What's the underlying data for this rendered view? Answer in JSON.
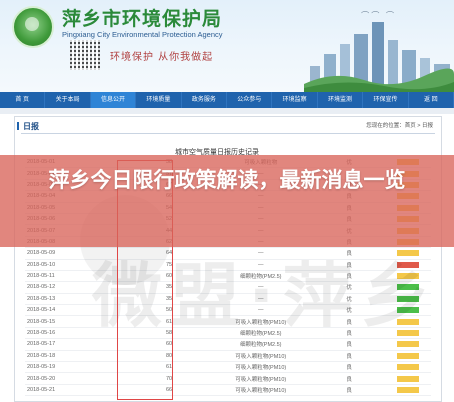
{
  "header": {
    "org_cn": "萍乡市环境保护局",
    "org_en": "Pingxiang City Environmental Protection Agency",
    "slogan": "环境保护 从你我做起",
    "logo_icon": "environment-agency-logo"
  },
  "nav": {
    "items": [
      "首 页",
      "关于本局",
      "信息公开",
      "环境质量",
      "政务服务",
      "公众参与",
      "环境监察",
      "环境监测",
      "环保宣传",
      "返 回"
    ],
    "active_index": 2
  },
  "panel": {
    "title": "日报",
    "breadcrumb": "您现在的位置：首页 > 日报",
    "table_caption": "城市空气质量日报历史记录"
  },
  "table": {
    "rows": [
      {
        "date": "2018-05-01",
        "aqi": "38",
        "pollutant": "可吸入颗粒物",
        "level": "优",
        "color": "#f4c84a"
      },
      {
        "date": "2018-05-02",
        "aqi": "51",
        "pollutant": "—",
        "level": "优",
        "color": "#f4c84a"
      },
      {
        "date": "2018-05-03",
        "aqi": "67",
        "pollutant": "—",
        "level": "良",
        "color": "#f4c84a"
      },
      {
        "date": "2018-05-04",
        "aqi": "66",
        "pollutant": "—",
        "level": "良",
        "color": "#f4c84a"
      },
      {
        "date": "2018-05-05",
        "aqi": "54",
        "pollutant": "—",
        "level": "良",
        "color": "#f4c84a"
      },
      {
        "date": "2018-05-06",
        "aqi": "52",
        "pollutant": "—",
        "level": "良",
        "color": "#f4c84a"
      },
      {
        "date": "2018-05-07",
        "aqi": "44",
        "pollutant": "—",
        "level": "优",
        "color": "#f4c84a"
      },
      {
        "date": "2018-05-08",
        "aqi": "62",
        "pollutant": "—",
        "level": "良",
        "color": "#f4c84a"
      },
      {
        "date": "2018-05-09",
        "aqi": "64",
        "pollutant": "—",
        "level": "良",
        "color": "#f4c84a"
      },
      {
        "date": "2018-05-10",
        "aqi": "75",
        "pollutant": "—",
        "level": "良",
        "color": "#e05a4a"
      },
      {
        "date": "2018-05-11",
        "aqi": "60",
        "pollutant": "细颗粒物(PM2.5)",
        "level": "良",
        "color": "#f4c84a"
      },
      {
        "date": "2018-05-12",
        "aqi": "35",
        "pollutant": "—",
        "level": "优",
        "color": "#4cbf4a"
      },
      {
        "date": "2018-05-13",
        "aqi": "35",
        "pollutant": "—",
        "level": "优",
        "color": "#4cbf4a"
      },
      {
        "date": "2018-05-14",
        "aqi": "50",
        "pollutant": "—",
        "level": "优",
        "color": "#4cbf4a"
      },
      {
        "date": "2018-05-15",
        "aqi": "61",
        "pollutant": "可吸入颗粒物(PM10)",
        "level": "良",
        "color": "#f4c84a"
      },
      {
        "date": "2018-05-16",
        "aqi": "58",
        "pollutant": "细颗粒物(PM2.5)",
        "level": "良",
        "color": "#f4c84a"
      },
      {
        "date": "2018-05-17",
        "aqi": "60",
        "pollutant": "细颗粒物(PM2.5)",
        "level": "良",
        "color": "#f4c84a"
      },
      {
        "date": "2018-05-18",
        "aqi": "80",
        "pollutant": "可吸入颗粒物(PM10)",
        "level": "良",
        "color": "#f4c84a"
      },
      {
        "date": "2018-05-19",
        "aqi": "61",
        "pollutant": "可吸入颗粒物(PM10)",
        "level": "良",
        "color": "#f4c84a"
      },
      {
        "date": "2018-05-20",
        "aqi": "70",
        "pollutant": "可吸入颗粒物(PM10)",
        "level": "良",
        "color": "#f4c84a"
      },
      {
        "date": "2018-05-21",
        "aqi": "66",
        "pollutant": "可吸入颗粒物(PM10)",
        "level": "良",
        "color": "#f4c84a"
      }
    ]
  },
  "overlay": {
    "headline": "萍乡今日限行政策解读，最新消息一览"
  },
  "watermark": {
    "text": "微盟·萍乡"
  }
}
